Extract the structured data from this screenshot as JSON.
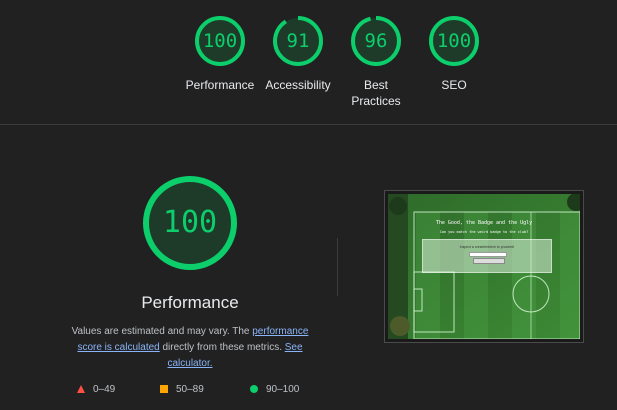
{
  "categories": [
    {
      "score": "100",
      "label": "Performance",
      "fraction": 1.0
    },
    {
      "score": "91",
      "label": "Accessibility",
      "fraction": 0.91
    },
    {
      "score": "96",
      "label": "Best\nPractices",
      "fraction": 0.96
    },
    {
      "score": "100",
      "label": "SEO",
      "fraction": 1.0
    }
  ],
  "main": {
    "score": "100",
    "fraction": 1.0,
    "title": "Performance",
    "desc_before": "Values are estimated and may vary. The ",
    "link1": "performance score is calculated",
    "desc_middle": " directly from these metrics. ",
    "link2": "See calculator."
  },
  "legend": {
    "fail": "0–49",
    "average": "50–89",
    "pass": "90–100"
  },
  "screenshot": {
    "heading": "The Good, the Badge and the Ugly",
    "subheading": "Can you match the weird badge to the club?",
    "prompt": "Inspect a crest/emblem to proceed!"
  },
  "colors": {
    "pass": "#0cce6b",
    "average": "#ffa400",
    "fail": "#ff4e42",
    "gauge_bg": "#1e3b2a"
  }
}
